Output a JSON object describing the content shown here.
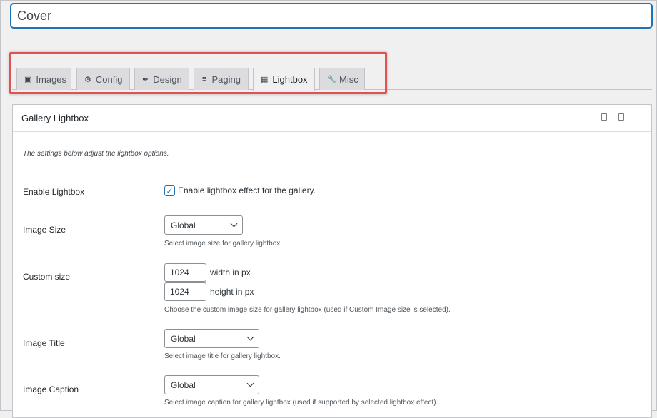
{
  "title": {
    "value": "Cover"
  },
  "tabs": [
    {
      "label": "Images",
      "icon": "images-icon"
    },
    {
      "label": "Config",
      "icon": "gear-icon"
    },
    {
      "label": "Design",
      "icon": "pin-icon"
    },
    {
      "label": "Paging",
      "icon": "menu-icon"
    },
    {
      "label": "Lightbox",
      "icon": "lightbox-icon",
      "active": true
    },
    {
      "label": "Misc",
      "icon": "wrench-icon"
    }
  ],
  "panel": {
    "title": "Gallery Lightbox",
    "description": "The settings below adjust the lightbox options."
  },
  "enable_lightbox": {
    "label": "Enable Lightbox",
    "checkbox_label": "Enable lightbox effect for the gallery.",
    "checked": true
  },
  "image_size": {
    "label": "Image Size",
    "selected": "Global",
    "hint": "Select image size for gallery lightbox."
  },
  "custom_size": {
    "label": "Custom size",
    "width_value": "1024",
    "width_unit": "width in px",
    "height_value": "1024",
    "height_unit": "height in px",
    "hint": "Choose the custom image size for gallery lightbox (used if Custom Image size is selected)."
  },
  "image_title": {
    "label": "Image Title",
    "selected": "Global",
    "hint": "Select image title for gallery lightbox."
  },
  "image_caption": {
    "label": "Image Caption",
    "selected": "Global",
    "hint": "Select image caption for gallery lightbox (used if supported by selected lightbox effect)."
  },
  "colors": {
    "accent": "#2271b1",
    "highlight": "#e05252"
  }
}
